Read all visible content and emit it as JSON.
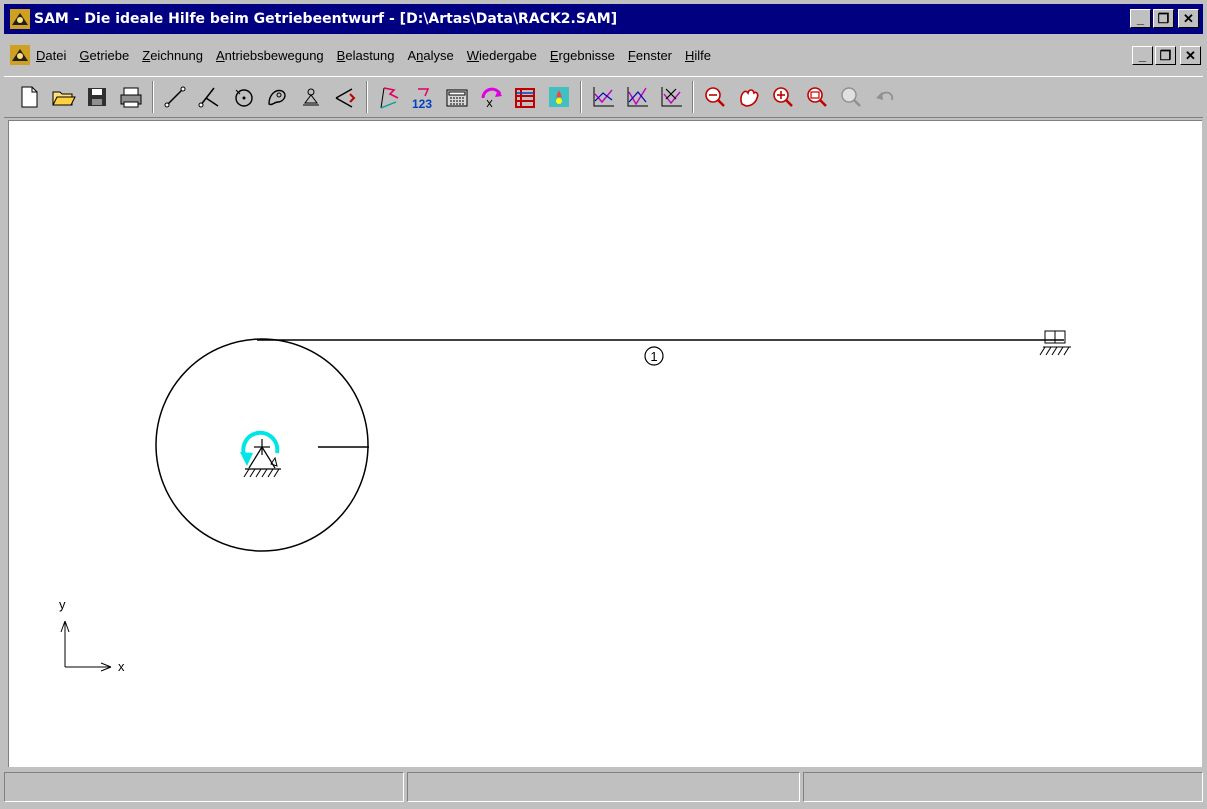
{
  "window": {
    "title": "SAM - Die ideale Hilfe beim Getriebeentwurf - [D:\\Artas\\Data\\RACK2.SAM]",
    "minimize": "_",
    "restore": "❐",
    "close": "✕"
  },
  "menu": [
    {
      "label": "Datei",
      "u": "D",
      "rest": "atei"
    },
    {
      "label": "Getriebe",
      "u": "G",
      "rest": "etriebe"
    },
    {
      "label": "Zeichnung",
      "u": "Z",
      "rest": "eichnung"
    },
    {
      "label": "Antriebsbewegung",
      "u": "A",
      "rest": "ntriebsbewegung"
    },
    {
      "label": "Belastung",
      "u": "B",
      "rest": "elastung"
    },
    {
      "label": "Analyse",
      "pre": "A",
      "u": "n",
      "rest": "alyse"
    },
    {
      "label": "Wiedergabe",
      "u": "W",
      "rest": "iedergabe"
    },
    {
      "label": "Ergebnisse",
      "u": "E",
      "rest": "rgebnisse"
    },
    {
      "label": "Fenster",
      "u": "F",
      "rest": "enster"
    },
    {
      "label": "Hilfe",
      "u": "H",
      "rest": "ilfe"
    }
  ],
  "toolbar": [
    "new-file-icon",
    "open-folder-icon",
    "save-disk-icon",
    "print-icon",
    "sep",
    "beam-element-icon",
    "slider-element-icon",
    "gear-element-icon",
    "cam-element-icon",
    "ground-support-icon",
    "spring-element-icon",
    "sep",
    "node-flag-icon",
    "numbering-123-icon",
    "calculator-icon",
    "drive-motion-icon",
    "load-icon",
    "animation-icon",
    "sep",
    "graph-1-icon",
    "graph-2-icon",
    "graph-3-icon",
    "sep",
    "zoom-out-icon",
    "pan-hand-icon",
    "zoom-in-icon",
    "zoom-window-icon",
    "zoom-all-icon",
    "undo-icon"
  ],
  "drawing": {
    "element_label": "1",
    "axis_x": "x",
    "axis_y": "y",
    "drive_color": "#00e5e5",
    "line_color": "#000000"
  },
  "statusbar": [
    "",
    "",
    ""
  ]
}
